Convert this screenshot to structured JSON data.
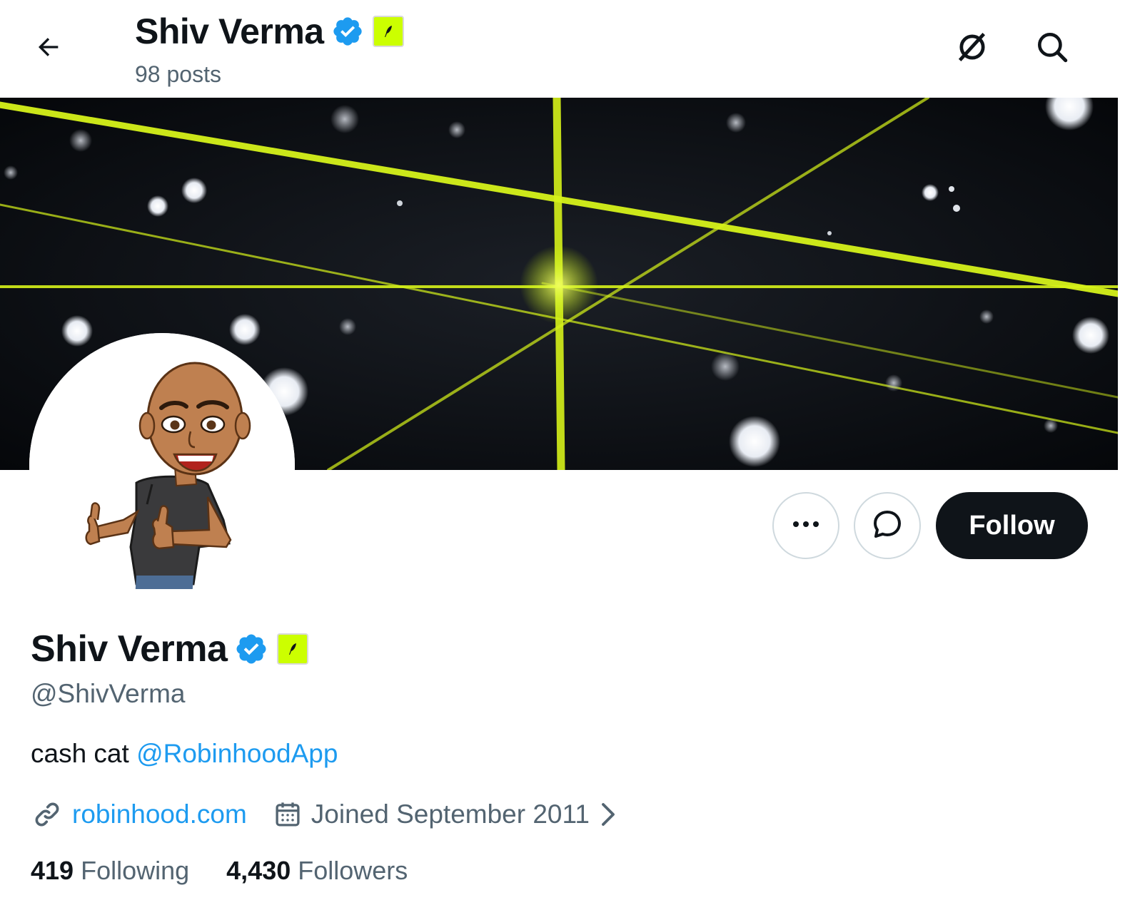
{
  "header": {
    "title": "Shiv Verma",
    "posts_count": "98 posts"
  },
  "profile": {
    "name": "Shiv Verma",
    "handle": "@ShivVerma",
    "bio_text": "cash cat ",
    "bio_mention": "@RobinhoodApp",
    "website": "robinhood.com",
    "joined": "Joined September 2011",
    "following_count": "419",
    "following_label": "Following",
    "followers_count": "4,430",
    "followers_label": "Followers"
  },
  "actions": {
    "follow_label": "Follow"
  },
  "icons": {
    "back": "arrow-left-icon",
    "grok": "grok-icon",
    "search": "search-icon",
    "verified": "verified-badge-icon",
    "affiliate": "robinhood-feather-icon",
    "more": "more-dots-icon",
    "message": "message-bubble-icon",
    "link": "link-icon",
    "calendar": "calendar-icon",
    "chevron": "chevron-right-icon"
  },
  "colors": {
    "accent": "#1d9bf0",
    "affiliate_bg": "#ccff00",
    "follow_bg": "#0f1419",
    "muted_text": "#536471"
  }
}
